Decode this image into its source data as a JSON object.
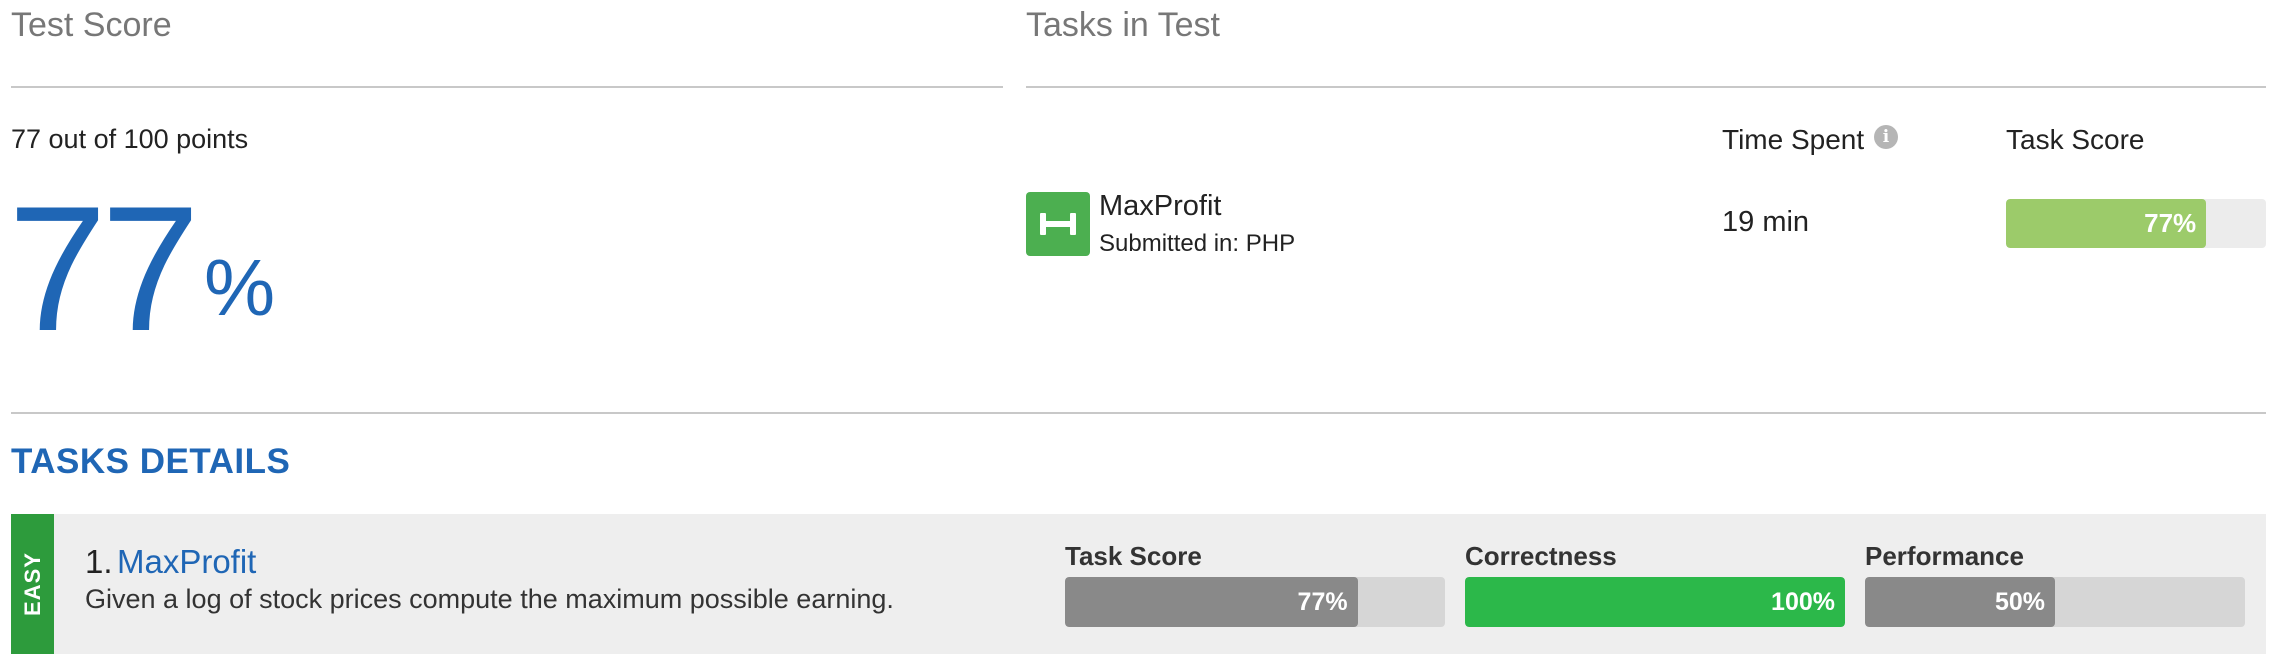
{
  "test_score": {
    "title": "Test Score",
    "points_text": "77 out of 100 points",
    "score_value": "77",
    "score_unit": "%"
  },
  "tasks_in_test": {
    "title": "Tasks in Test",
    "time_spent_header": "Time Spent",
    "info_icon": "i",
    "task_score_header": "Task Score",
    "tasks": [
      {
        "icon": "dumbbell-icon",
        "name": "MaxProfit",
        "submitted": "Submitted in: PHP",
        "time": "19 min",
        "score_label": "77%",
        "score_fraction": 0.77
      }
    ]
  },
  "tasks_details": {
    "title": "TASKS DETAILS",
    "items": [
      {
        "difficulty": "EASY",
        "number": "1.",
        "name": "MaxProfit",
        "description": "Given a log of stock prices compute the maximum possible earning.",
        "metrics": [
          {
            "label": "Task Score",
            "value_label": "77%",
            "fraction": 0.77,
            "color": "#898989"
          },
          {
            "label": "Correctness",
            "value_label": "100%",
            "fraction": 1.0,
            "color": "#2cb84a"
          },
          {
            "label": "Performance",
            "value_label": "50%",
            "fraction": 0.5,
            "color": "#898989"
          }
        ]
      }
    ]
  },
  "colors": {
    "accent_blue": "#1f66b5",
    "task_bar_green": "#9ccb6a",
    "icon_green": "#4caf50",
    "easy_green": "#2d9b3c"
  }
}
